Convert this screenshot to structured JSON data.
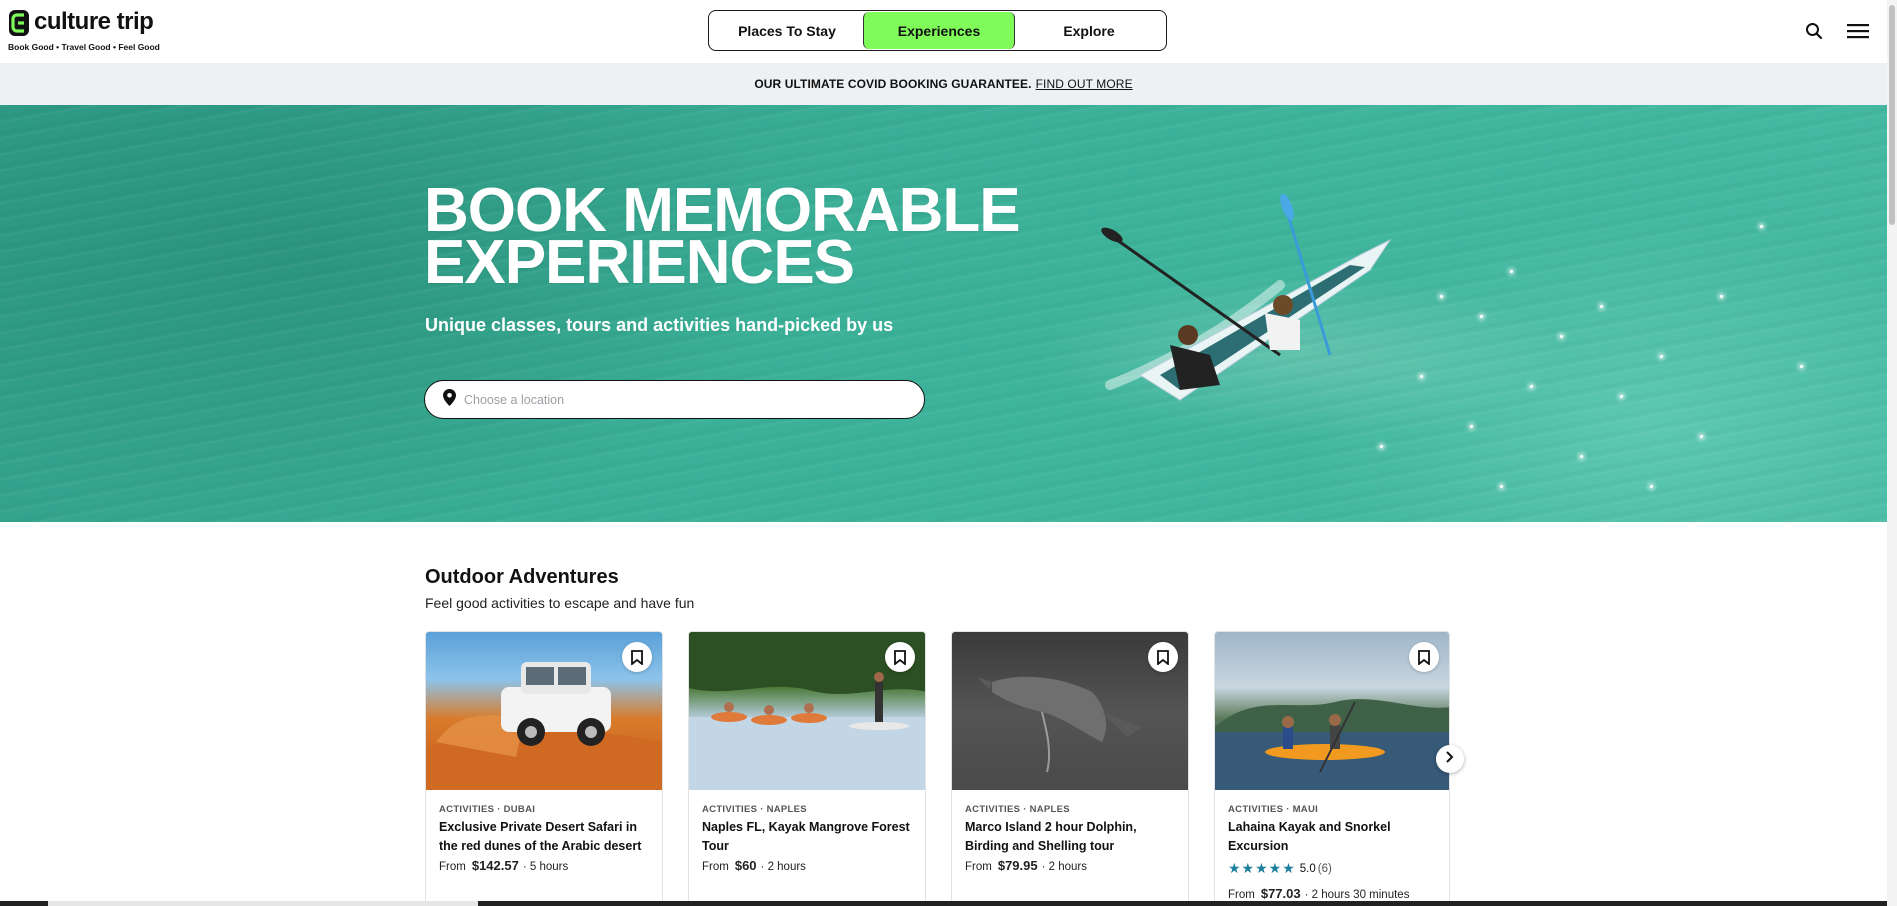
{
  "logo": {
    "name": "culture trip",
    "tagline": "Book Good • Travel Good • Feel Good"
  },
  "nav": {
    "tabs": [
      {
        "label": "Places To Stay",
        "active": false
      },
      {
        "label": "Experiences",
        "active": true
      },
      {
        "label": "Explore",
        "active": false
      }
    ],
    "icons": [
      "search-icon",
      "menu-icon"
    ]
  },
  "banner": {
    "text": "OUR ULTIMATE COVID BOOKING GUARANTEE.",
    "link": "FIND OUT MORE"
  },
  "hero": {
    "title_line1": "BOOK MEMORABLE",
    "title_line2": "EXPERIENCES",
    "subtitle": "Unique classes, tours and activities hand-picked by us",
    "search_placeholder": "Choose a location"
  },
  "section": {
    "title": "Outdoor Adventures",
    "subtitle": "Feel good activities to escape and have fun",
    "cards": [
      {
        "category": "ACTIVITIES · DUBAI",
        "title": "Exclusive Private Desert Safari in the red dunes of the Arabic desert",
        "from": "From",
        "price": "$142.57",
        "duration": "· 5 hours"
      },
      {
        "category": "ACTIVITIES · NAPLES",
        "title": "Naples FL, Kayak Mangrove Forest Tour",
        "from": "From",
        "price": "$60",
        "duration": "· 2 hours"
      },
      {
        "category": "ACTIVITIES · NAPLES",
        "title": "Marco Island 2 hour Dolphin, Birding and Shelling tour",
        "from": "From",
        "price": "$79.95",
        "duration": "· 2 hours"
      },
      {
        "category": "ACTIVITIES · MAUI",
        "title": "Lahaina Kayak and Snorkel Excursion",
        "rating": "5.0",
        "rating_count": "(6)",
        "stars": "★★★★★",
        "from": "From",
        "price": "$77.03",
        "duration": "· 2 hours 30 minutes"
      }
    ]
  },
  "colors": {
    "accent": "#7ffb5a",
    "rating": "#1f7f9e",
    "banner_bg": "#eef1f4"
  }
}
